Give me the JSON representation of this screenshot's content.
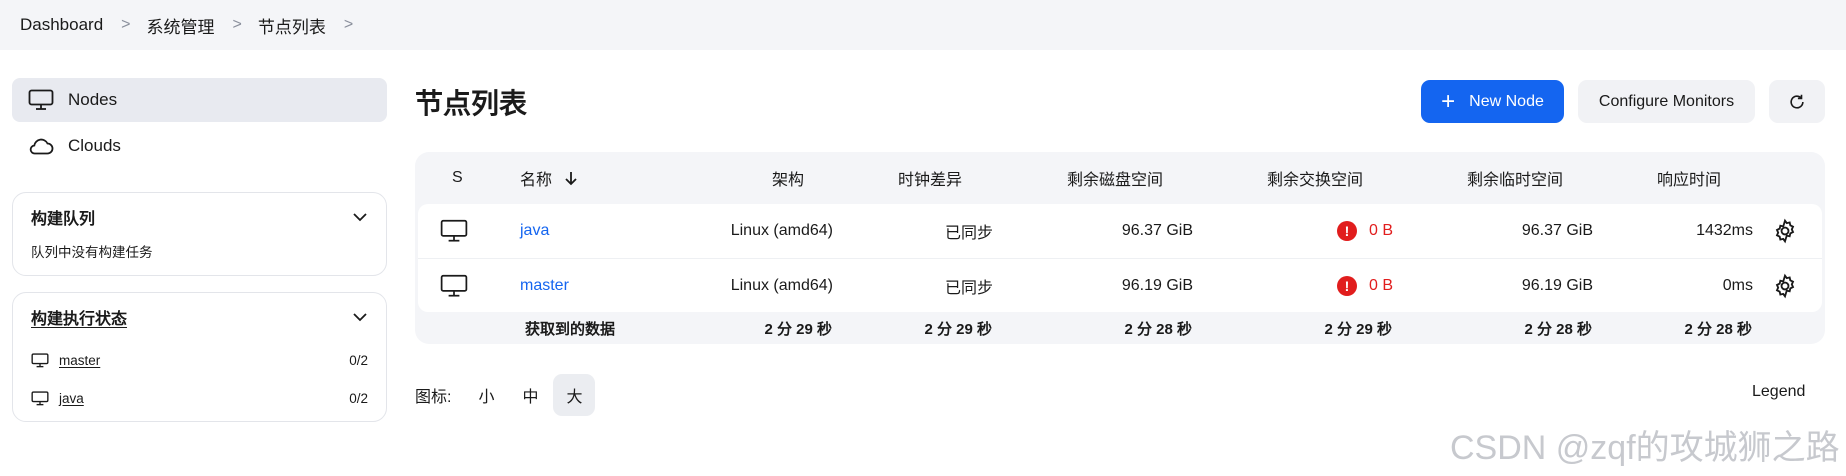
{
  "breadcrumb": [
    "Dashboard",
    "系统管理",
    "节点列表"
  ],
  "sidebar": {
    "items": [
      {
        "label": "Nodes",
        "icon": "monitor-icon",
        "active": true
      },
      {
        "label": "Clouds",
        "icon": "cloud-icon",
        "active": false
      }
    ],
    "build_queue": {
      "title": "构建队列",
      "empty_text": "队列中没有构建任务"
    },
    "executor_status": {
      "title": "构建执行状态",
      "nodes": [
        {
          "name": "master",
          "count": "0/2"
        },
        {
          "name": "java",
          "count": "0/2"
        }
      ]
    }
  },
  "main": {
    "title": "节点列表",
    "new_node_label": "New Node",
    "configure_monitors_label": "Configure Monitors",
    "refresh_icon": "refresh-icon"
  },
  "table": {
    "headers": {
      "status": "S",
      "name": "名称",
      "arch": "架构",
      "clock": "时钟差异",
      "disk": "剩余磁盘空间",
      "swap": "剩余交换空间",
      "temp": "剩余临时空间",
      "response": "响应时间"
    },
    "rows": [
      {
        "name": "java",
        "arch": "Linux (amd64)",
        "clock": "已同步",
        "disk": "96.37 GiB",
        "swap": "0 B",
        "temp": "96.37 GiB",
        "response": "1432ms"
      },
      {
        "name": "master",
        "arch": "Linux (amd64)",
        "clock": "已同步",
        "disk": "96.19 GiB",
        "swap": "0 B",
        "temp": "96.19 GiB",
        "response": "0ms"
      }
    ],
    "footer": {
      "label": "获取到的数据",
      "arch": "2 分 29 秒",
      "clock": "2 分 29 秒",
      "disk": "2 分 28 秒",
      "swap": "2 分 29 秒",
      "temp": "2 分 28 秒",
      "response": "2 分 28 秒"
    },
    "error_symbol": "!"
  },
  "icon_size": {
    "label": "图标:",
    "options": [
      "小",
      "中",
      "大"
    ],
    "selected": "大"
  },
  "legend_label": "Legend",
  "watermark": "CSDN @zqf的攻城狮之路",
  "colors": {
    "accent": "#1465f0",
    "error": "#e11d1d"
  }
}
